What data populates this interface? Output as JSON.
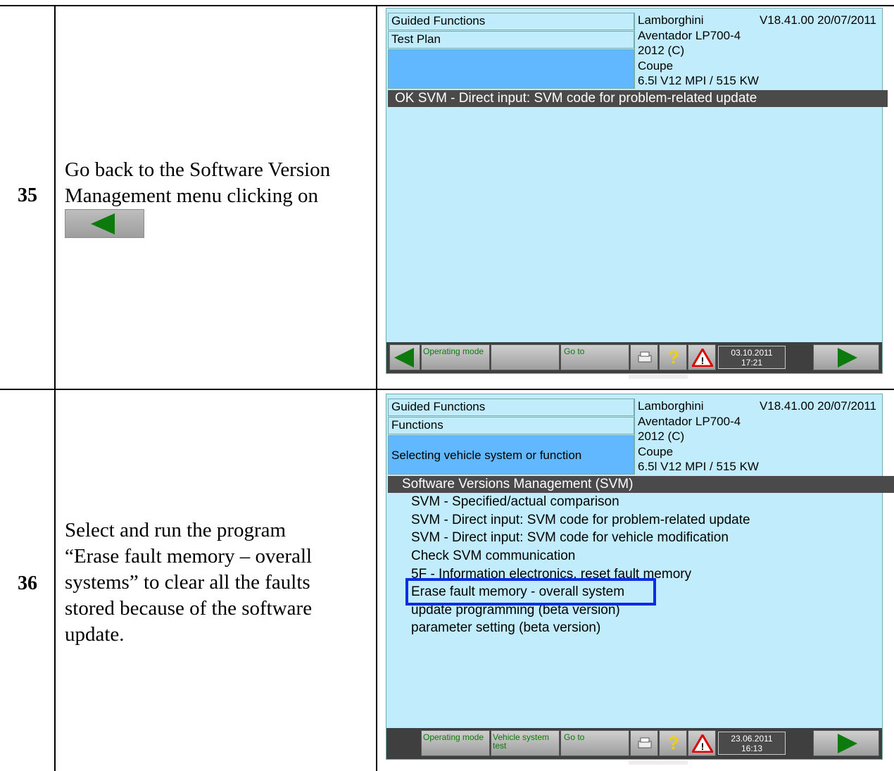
{
  "steps": [
    {
      "number": "35",
      "instruction_line1": "Go back to the Software Version",
      "instruction_line2": "Management menu clicking on",
      "button_icon": "back-arrow-icon",
      "screen": {
        "header_left": [
          "Guided Functions",
          "Test Plan",
          ""
        ],
        "vehicle": [
          "Lamborghini",
          "Aventador LP700-4",
          "2012 (C)",
          "Coupe",
          "6.5l V12 MPI / 515 KW"
        ],
        "version": "V18.41.00 20/07/2011",
        "status_bar": "OK   SVM - Direct input: SVM code for problem-related update",
        "toolbar": {
          "operating_mode": "Operating mode",
          "vehicle_system_test": "",
          "go_to": "Go to",
          "date": "03.10.2011",
          "time": "17:21"
        }
      }
    },
    {
      "number": "36",
      "instruction_lines": [
        "Select and run the program",
        "“Erase fault memory – overall",
        "systems” to clear all the faults",
        "stored because of the software",
        "update."
      ],
      "screen": {
        "header_left": [
          "Guided Functions",
          "Functions",
          "Selecting vehicle system or function"
        ],
        "vehicle": [
          "Lamborghini",
          "Aventador LP700-4",
          "2012 (C)",
          "Coupe",
          "6.5l V12 MPI / 515 KW"
        ],
        "version": "V18.41.00 20/07/2011",
        "menu_title": "Software Versions Management (SVM)",
        "menu_items": [
          "SVM - Specified/actual comparison",
          "SVM - Direct input: SVM code for problem-related update",
          "SVM - Direct input: SVM code for vehicle modification",
          "Check SVM communication",
          "5F - Information electronics, reset fault memory",
          "Erase fault memory - overall system",
          "update programming (beta version)",
          "parameter setting (beta version)"
        ],
        "toolbar": {
          "operating_mode": "Operating mode",
          "vehicle_system_line1": "Vehicle system",
          "vehicle_system_line2": "test",
          "go_to": "Go to",
          "date": "23.06.2011",
          "time": "16:13"
        }
      }
    }
  ],
  "colors": {
    "screen_bg": "#c1ecfb",
    "selected_header": "#62b8ff",
    "highlight_box": "#0a2ee6",
    "status_bar": "#4a4a4a"
  }
}
